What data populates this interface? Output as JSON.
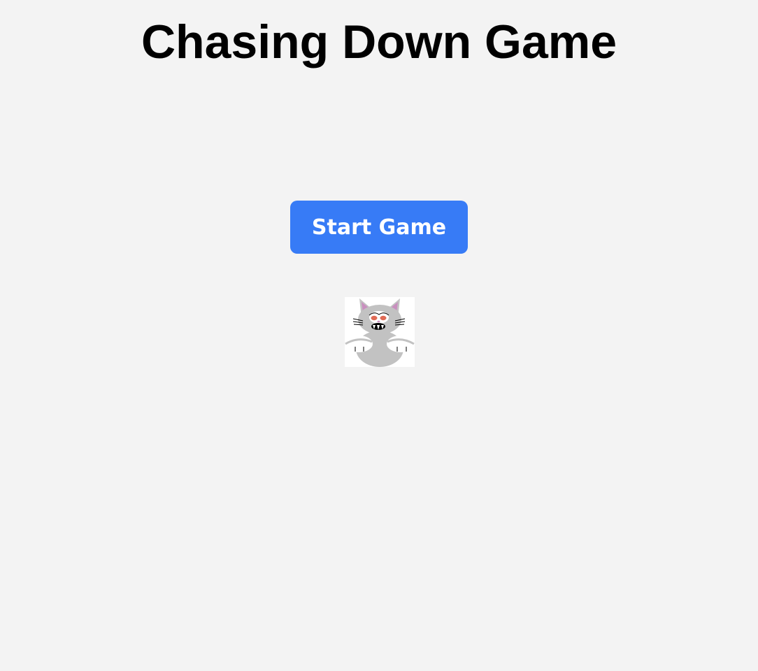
{
  "page": {
    "title": "Chasing Down Game"
  },
  "controls": {
    "start_label": "Start Game"
  },
  "sprite": {
    "icon": "cat-icon",
    "accent_color": "#377bf6",
    "background_color": "#f3f3f3"
  }
}
